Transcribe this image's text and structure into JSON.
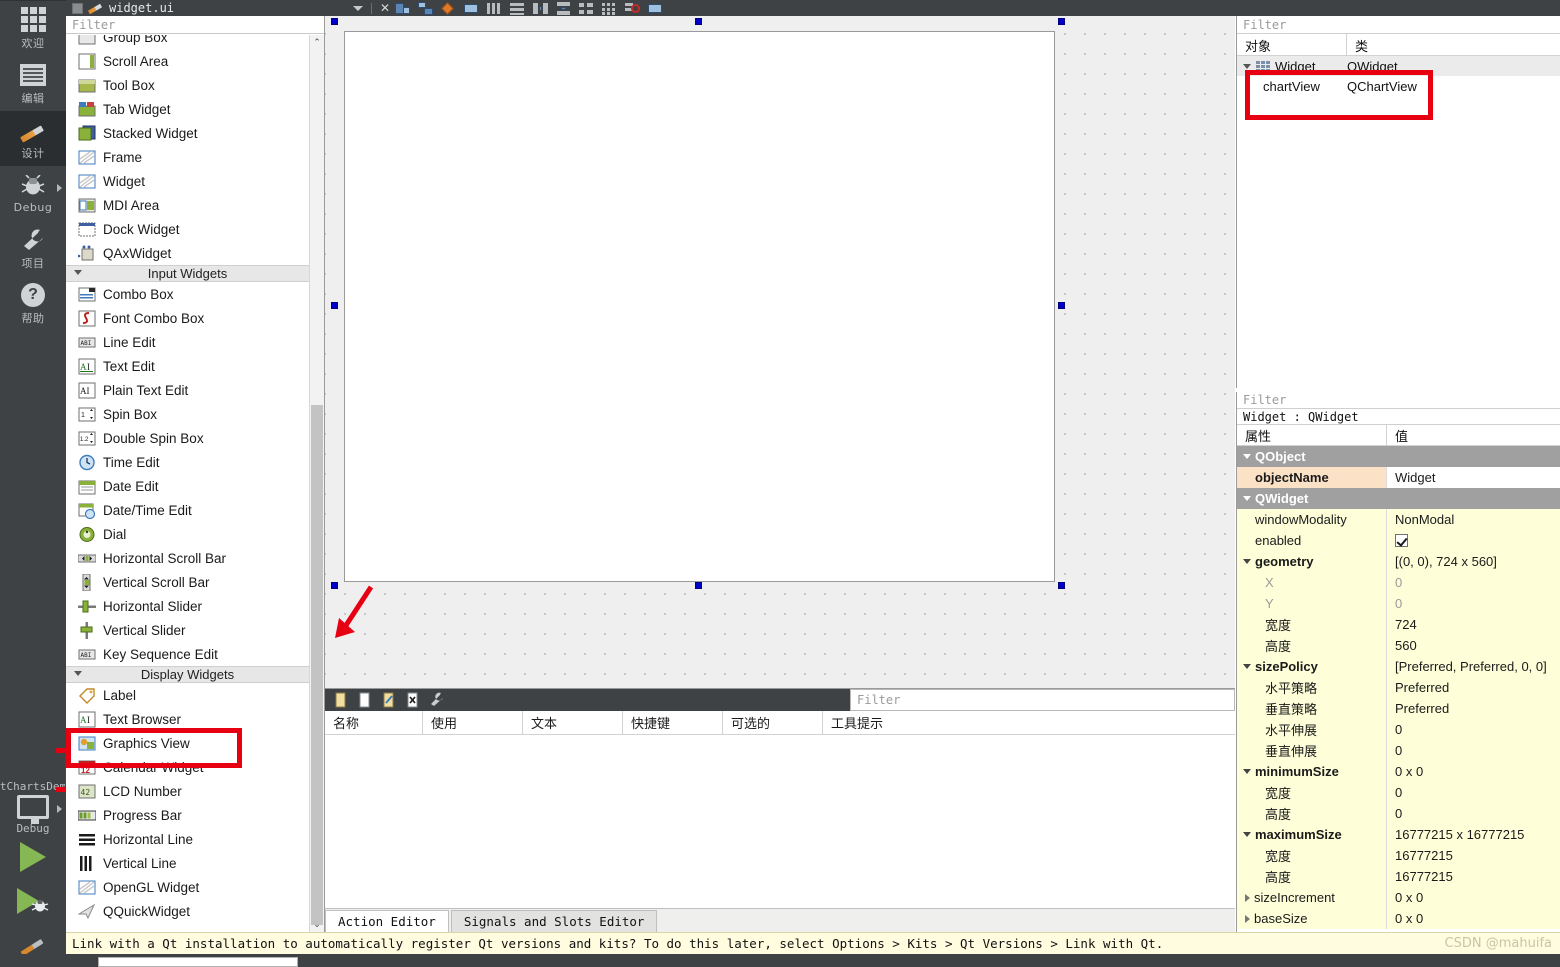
{
  "window": {
    "file_tab_label": "widget.ui"
  },
  "modebar": {
    "items": [
      {
        "label": "欢迎",
        "icon": "grid-icon"
      },
      {
        "label": "编辑",
        "icon": "lines-icon"
      },
      {
        "label": "设计",
        "icon": "pencil-icon"
      },
      {
        "label": "Debug",
        "icon": "bug-icon"
      },
      {
        "label": "项目",
        "icon": "wrench-icon"
      },
      {
        "label": "帮助",
        "icon": "help-icon"
      }
    ],
    "kit_name": "QtChartsDemo",
    "build_config": "Debug"
  },
  "widget_box": {
    "filter_placeholder": "Filter",
    "items": [
      {
        "type": "item",
        "label": "Group Box",
        "icon": "group-box-icon"
      },
      {
        "type": "item",
        "label": "Scroll Area",
        "icon": "scroll-area-icon"
      },
      {
        "type": "item",
        "label": "Tool Box",
        "icon": "tool-box-icon"
      },
      {
        "type": "item",
        "label": "Tab Widget",
        "icon": "tab-widget-icon"
      },
      {
        "type": "item",
        "label": "Stacked Widget",
        "icon": "stacked-widget-icon"
      },
      {
        "type": "item",
        "label": "Frame",
        "icon": "frame-icon"
      },
      {
        "type": "item",
        "label": "Widget",
        "icon": "widget-icon"
      },
      {
        "type": "item",
        "label": "MDI Area",
        "icon": "mdi-area-icon"
      },
      {
        "type": "item",
        "label": "Dock Widget",
        "icon": "dock-widget-icon"
      },
      {
        "type": "item",
        "label": "QAxWidget",
        "icon": "qax-widget-icon"
      },
      {
        "type": "category",
        "label": "Input Widgets"
      },
      {
        "type": "item",
        "label": "Combo Box",
        "icon": "combo-box-icon"
      },
      {
        "type": "item",
        "label": "Font Combo Box",
        "icon": "font-combo-box-icon"
      },
      {
        "type": "item",
        "label": "Line Edit",
        "icon": "line-edit-icon"
      },
      {
        "type": "item",
        "label": "Text Edit",
        "icon": "text-edit-icon"
      },
      {
        "type": "item",
        "label": "Plain Text Edit",
        "icon": "plain-text-edit-icon"
      },
      {
        "type": "item",
        "label": "Spin Box",
        "icon": "spin-box-icon"
      },
      {
        "type": "item",
        "label": "Double Spin Box",
        "icon": "double-spin-box-icon"
      },
      {
        "type": "item",
        "label": "Time Edit",
        "icon": "time-edit-icon"
      },
      {
        "type": "item",
        "label": "Date Edit",
        "icon": "date-edit-icon"
      },
      {
        "type": "item",
        "label": "Date/Time Edit",
        "icon": "date-time-edit-icon"
      },
      {
        "type": "item",
        "label": "Dial",
        "icon": "dial-icon"
      },
      {
        "type": "item",
        "label": "Horizontal Scroll Bar",
        "icon": "h-scrollbar-icon"
      },
      {
        "type": "item",
        "label": "Vertical Scroll Bar",
        "icon": "v-scrollbar-icon"
      },
      {
        "type": "item",
        "label": "Horizontal Slider",
        "icon": "h-slider-icon"
      },
      {
        "type": "item",
        "label": "Vertical Slider",
        "icon": "v-slider-icon"
      },
      {
        "type": "item",
        "label": "Key Sequence Edit",
        "icon": "key-sequence-edit-icon"
      },
      {
        "type": "category",
        "label": "Display Widgets"
      },
      {
        "type": "item",
        "label": "Label",
        "icon": "label-icon"
      },
      {
        "type": "item",
        "label": "Text Browser",
        "icon": "text-browser-icon"
      },
      {
        "type": "item",
        "label": "Graphics View",
        "icon": "graphics-view-icon"
      },
      {
        "type": "item",
        "label": "Calendar Widget",
        "icon": "calendar-widget-icon"
      },
      {
        "type": "item",
        "label": "LCD Number",
        "icon": "lcd-number-icon"
      },
      {
        "type": "item",
        "label": "Progress Bar",
        "icon": "progress-bar-icon"
      },
      {
        "type": "item",
        "label": "Horizontal Line",
        "icon": "h-line-icon"
      },
      {
        "type": "item",
        "label": "Vertical Line",
        "icon": "v-line-icon"
      },
      {
        "type": "item",
        "label": "OpenGL Widget",
        "icon": "opengl-widget-icon"
      },
      {
        "type": "item",
        "label": "QQuickWidget",
        "icon": "qquick-widget-icon"
      }
    ]
  },
  "object_inspector": {
    "filter_placeholder": "Filter",
    "columns": [
      "对象",
      "类"
    ],
    "rows": [
      {
        "object": "Widget",
        "class": "QWidget",
        "depth": 0
      },
      {
        "object": "chartView",
        "class": "QChartView",
        "depth": 1
      }
    ]
  },
  "property_editor": {
    "filter_placeholder": "Filter",
    "object_header": "Widget : QWidget",
    "columns": [
      "属性",
      "值"
    ],
    "rows": [
      {
        "kind": "group",
        "name": "QObject",
        "value": ""
      },
      {
        "kind": "highlight",
        "name": "objectName",
        "value": "Widget"
      },
      {
        "kind": "group",
        "name": "QWidget",
        "value": ""
      },
      {
        "kind": "prop",
        "name": "windowModality",
        "value": "NonModal"
      },
      {
        "kind": "prop",
        "name": "enabled",
        "value": "",
        "checkbox": true
      },
      {
        "kind": "expand",
        "name": "geometry",
        "value": "[(0, 0), 724 x 560]"
      },
      {
        "kind": "child-muted",
        "name": "X",
        "value": "0"
      },
      {
        "kind": "child-muted",
        "name": "Y",
        "value": "0"
      },
      {
        "kind": "child",
        "name": "宽度",
        "value": "724"
      },
      {
        "kind": "child",
        "name": "高度",
        "value": "560"
      },
      {
        "kind": "expand",
        "name": "sizePolicy",
        "value": "[Preferred, Preferred, 0, 0]"
      },
      {
        "kind": "child",
        "name": "水平策略",
        "value": "Preferred"
      },
      {
        "kind": "child",
        "name": "垂直策略",
        "value": "Preferred"
      },
      {
        "kind": "child",
        "name": "水平伸展",
        "value": "0"
      },
      {
        "kind": "child",
        "name": "垂直伸展",
        "value": "0"
      },
      {
        "kind": "expand",
        "name": "minimumSize",
        "value": "0 x 0"
      },
      {
        "kind": "child",
        "name": "宽度",
        "value": "0"
      },
      {
        "kind": "child",
        "name": "高度",
        "value": "0"
      },
      {
        "kind": "expand",
        "name": "maximumSize",
        "value": "16777215 x 16777215"
      },
      {
        "kind": "child",
        "name": "宽度",
        "value": "16777215"
      },
      {
        "kind": "child",
        "name": "高度",
        "value": "16777215"
      },
      {
        "kind": "collapsed",
        "name": "sizeIncrement",
        "value": "0 x 0"
      },
      {
        "kind": "collapsed",
        "name": "baseSize",
        "value": "0 x 0"
      }
    ]
  },
  "action_editor": {
    "filter_placeholder": "Filter",
    "columns": [
      "名称",
      "使用",
      "文本",
      "快捷键",
      "可选的",
      "工具提示"
    ],
    "rows": [],
    "tabs": [
      {
        "label": "Action Editor",
        "active": true
      },
      {
        "label": "Signals and Slots Editor",
        "active": false
      }
    ]
  },
  "status": {
    "message": "Link with a Qt installation to automatically register Qt versions and kits? To do this later, select Options > Kits > Qt Versions > Link with Qt.",
    "watermark": "CSDN @mahuifa"
  },
  "form_canvas": {
    "selected_object": "Widget"
  },
  "colors": {
    "accent_red": "#e60012",
    "selection_handle": "#0000c8",
    "chrome_dark": "#3f4244",
    "property_yellow": "#feffd9",
    "property_peach": "#fbe2c6",
    "group_gray": "#a0a0a0",
    "status_bg": "#fffce0"
  }
}
